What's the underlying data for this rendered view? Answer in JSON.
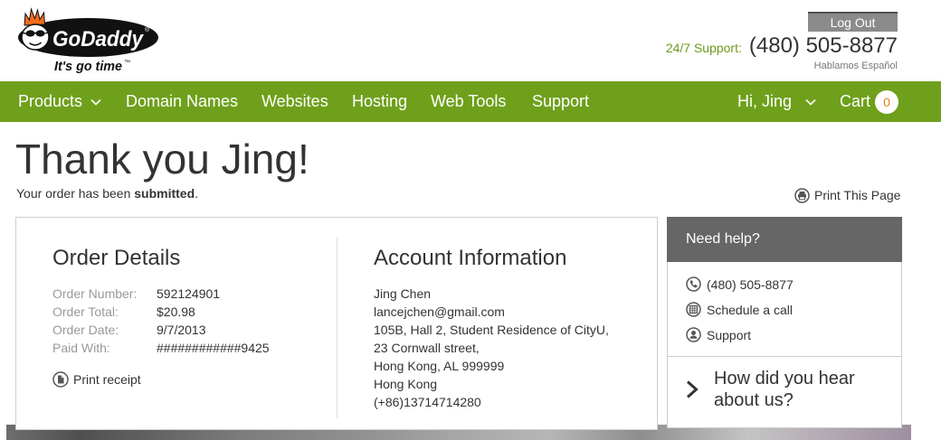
{
  "header": {
    "logo": {
      "wordmark": "GoDaddy",
      "registered_mark": "®",
      "tagline": "It's go time",
      "trademark": "™",
      "mascot_icon": "godaddy-mascot-icon"
    },
    "logout_label": "Log Out",
    "support_label": "24/7 Support:",
    "support_phone": "(480) 505-8877",
    "support_language_note": "Hablamos Español"
  },
  "nav": {
    "items": [
      {
        "label": "Products",
        "dropdown": true
      },
      {
        "label": "Domain Names"
      },
      {
        "label": "Websites"
      },
      {
        "label": "Hosting"
      },
      {
        "label": "Web Tools"
      },
      {
        "label": "Support"
      }
    ],
    "account": {
      "greeting": "Hi, Jing",
      "dropdown": true
    },
    "cart": {
      "label": "Cart",
      "count": "0"
    }
  },
  "confirmation": {
    "title": "Thank you Jing!",
    "message_prefix": "Your order has been ",
    "message_emphasis": "submitted",
    "message_suffix": ".",
    "print_page": {
      "label": "Print This Page",
      "icon": "printer-icon"
    }
  },
  "order_details": {
    "heading": "Order Details",
    "rows": [
      {
        "label": "Order Number:",
        "value": "592124901"
      },
      {
        "label": "Order Total:",
        "value": "$20.98"
      },
      {
        "label": "Order Date:",
        "value": "9/7/2013"
      },
      {
        "label": "Paid With:",
        "value": "############9425"
      }
    ],
    "print_receipt": {
      "label": "Print receipt",
      "icon": "receipt-icon"
    }
  },
  "account_information": {
    "heading": "Account Information",
    "lines": [
      "Jing Chen",
      "lancejchen@gmail.com",
      "105B, Hall 2, Student Residence of CityU,",
      "23 Cornwall street,",
      "Hong Kong, AL 999999",
      "Hong Kong",
      "(+86)13714714280"
    ]
  },
  "help_panel": {
    "heading": "Need help?",
    "links": [
      {
        "label": "(480) 505-8877",
        "icon": "phone-icon"
      },
      {
        "label": "Schedule a call",
        "icon": "calendar-icon"
      },
      {
        "label": "Support",
        "icon": "user-icon"
      }
    ],
    "survey": {
      "label": "How did you hear about us?",
      "icon": "chevron-right-icon"
    }
  },
  "colors": {
    "nav_green": "#6fa01c",
    "support_green": "#6c9a1c",
    "cart_badge_text": "#e8801a",
    "help_header_bg": "#666666",
    "logout_bg": "#8b8b8b"
  }
}
